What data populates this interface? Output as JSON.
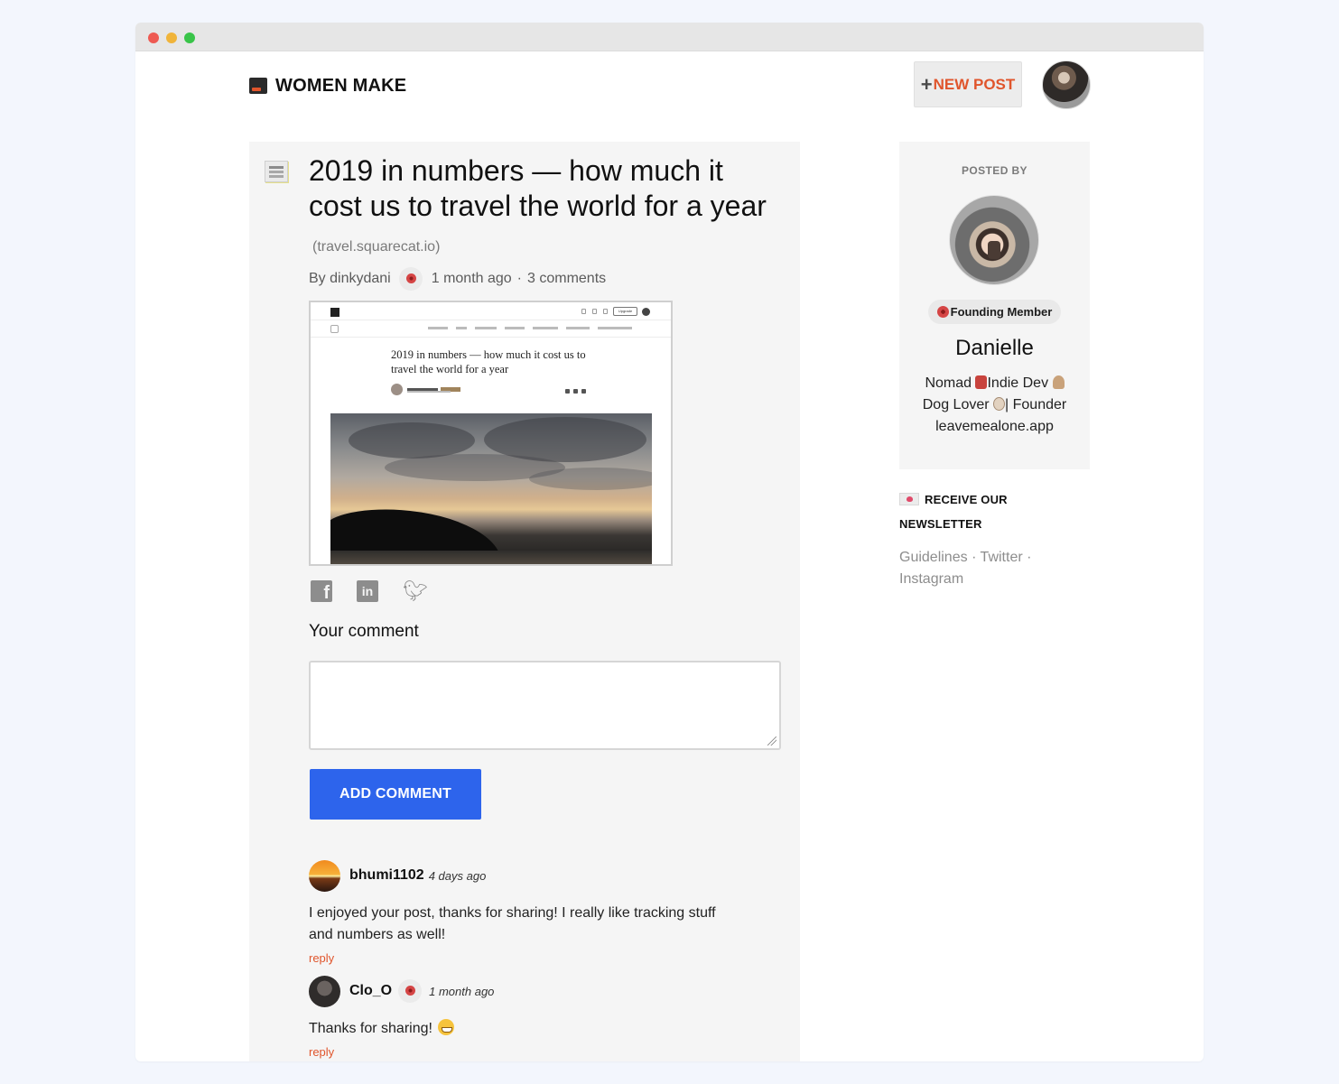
{
  "app": {
    "brand": "WOMEN MAKE",
    "accent_color": "#e0552c",
    "button_color": "#2d64ec"
  },
  "header": {
    "new_post_icon": "plus-icon",
    "new_post_label": "NEW POST"
  },
  "post": {
    "title": "2019 in numbers — how much it cost us to travel the world for a year",
    "domain": "(travel.squarecat.io)",
    "by": "By dinkydani",
    "time": "1 month ago",
    "dot": "·",
    "comments": "3 comments",
    "preview": {
      "headline": "2019 in numbers — how much it cost us to travel the world for a year",
      "upgrade": "Upgrade"
    }
  },
  "comment_form": {
    "label": "Your comment",
    "placeholder": "",
    "button": "ADD COMMENT"
  },
  "comments": [
    {
      "user": "bhumi1102",
      "time": "4 days ago",
      "body": "I enjoyed your post, thanks for sharing! I really like tracking stuff and numbers as well!",
      "reply": "reply"
    },
    {
      "user": "Clo_O",
      "time": "1 month ago",
      "body": "Thanks for sharing!",
      "reply": "reply"
    }
  ],
  "sidebar": {
    "posted_by": "POSTED BY",
    "badge": "Founding Member",
    "name": "Danielle",
    "bio_1": "Nomad",
    "bio_2": "Indie Dev",
    "bio_3": "Dog Lover",
    "bio_4": "| Founder",
    "bio_5": "leavemealone.app",
    "newsletter": "RECEIVE OUR NEWSLETTER",
    "links": [
      "Guidelines",
      "Twitter",
      "Instagram"
    ],
    "link_sep": "·"
  }
}
